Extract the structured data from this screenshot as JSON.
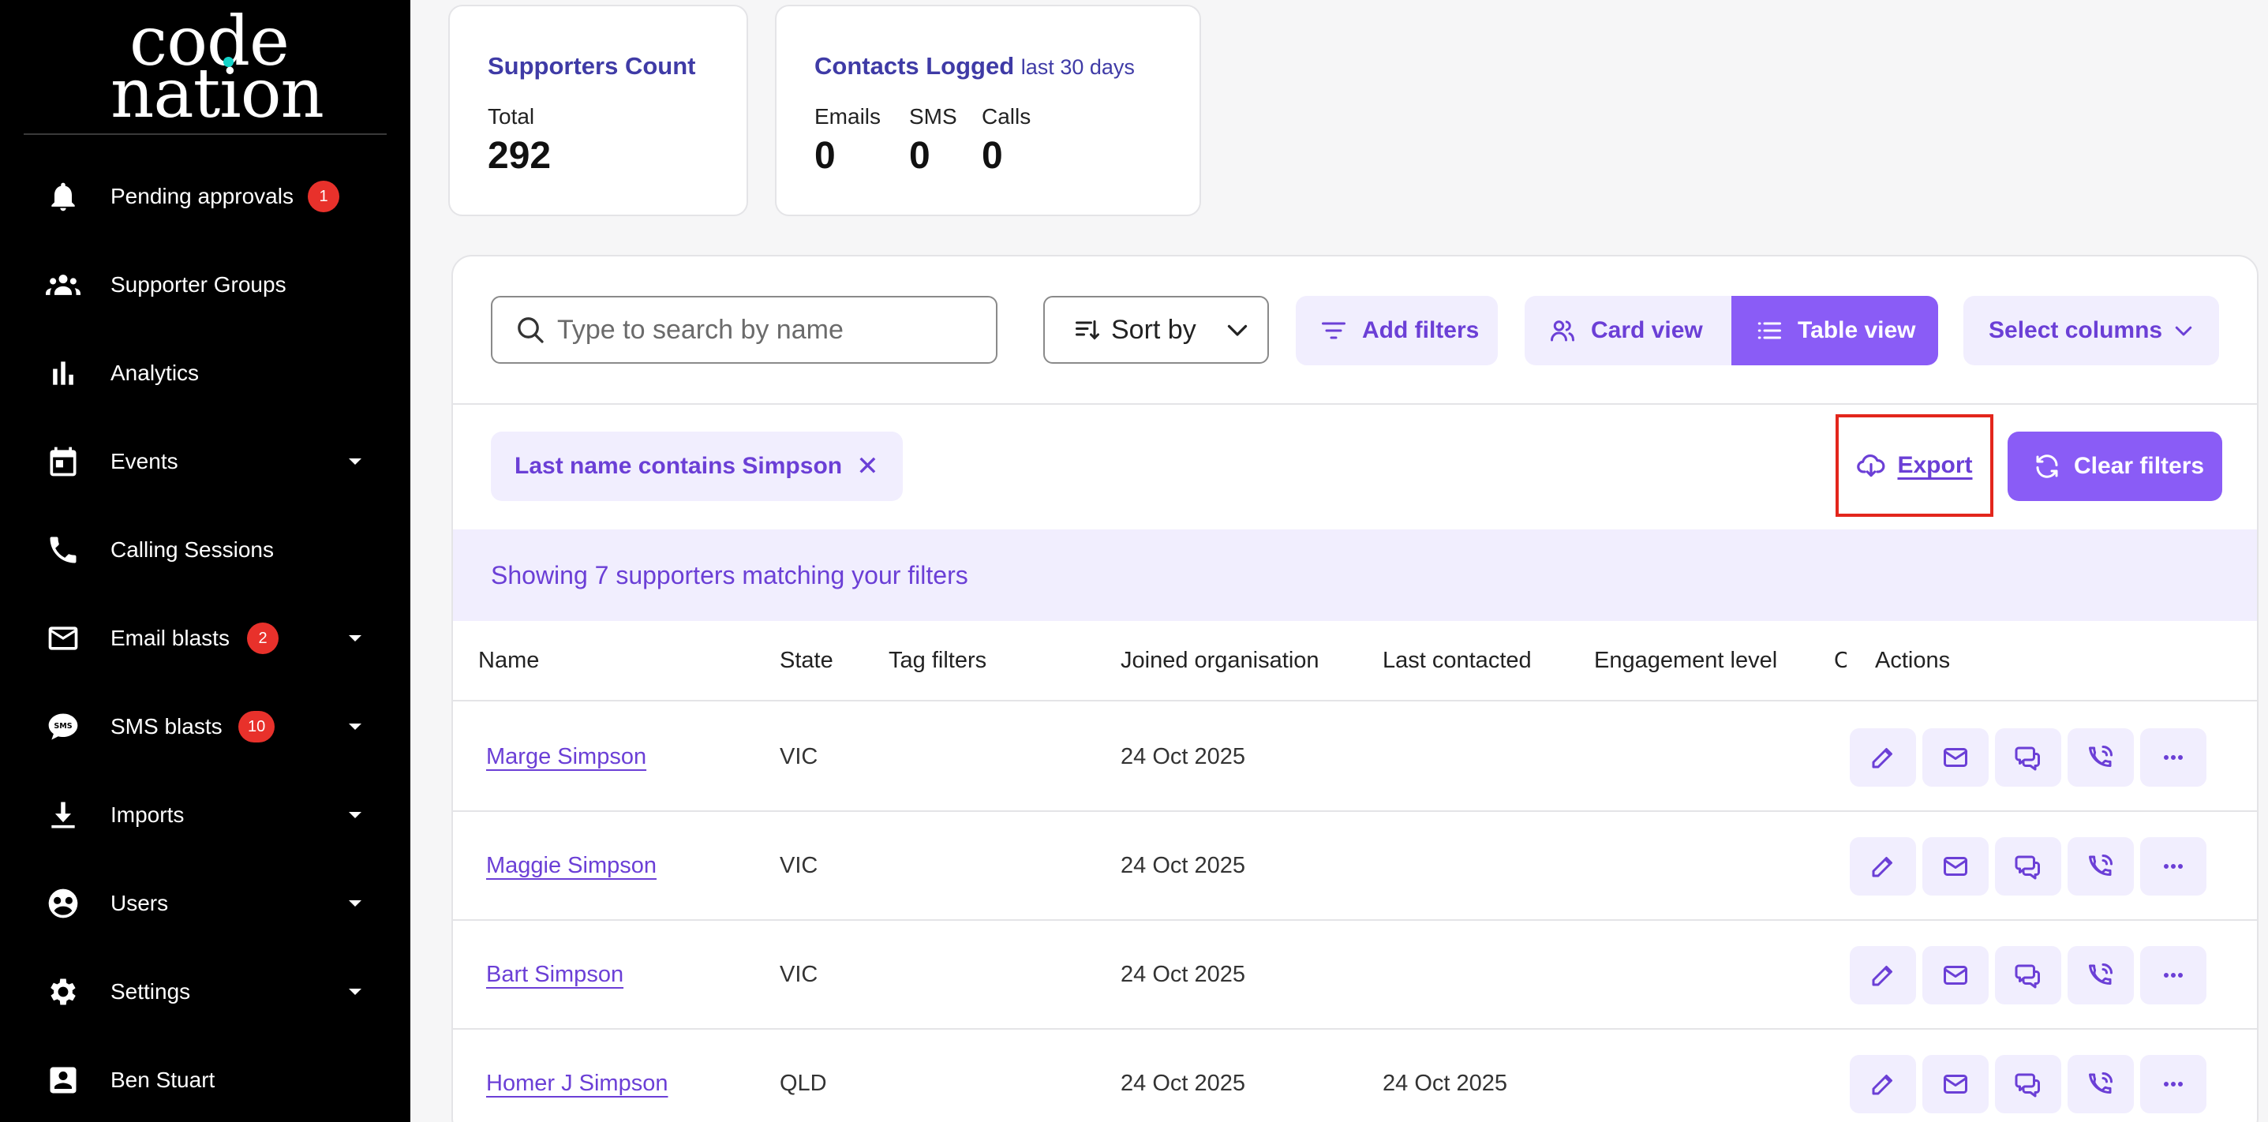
{
  "brand": {
    "line1": "code",
    "line2": "nation"
  },
  "sidebar": {
    "items": [
      {
        "label": "Pending approvals",
        "icon": "bell-icon",
        "badge": "1"
      },
      {
        "label": "Supporter Groups",
        "icon": "groups-icon"
      },
      {
        "label": "Analytics",
        "icon": "bar-chart-icon"
      },
      {
        "label": "Events",
        "icon": "calendar-icon",
        "expandable": true
      },
      {
        "label": "Calling Sessions",
        "icon": "phone-icon"
      },
      {
        "label": "Email blasts",
        "icon": "mail-icon",
        "badge": "2",
        "expandable": true
      },
      {
        "label": "SMS blasts",
        "icon": "sms-icon",
        "badge": "10",
        "expandable": true
      },
      {
        "label": "Imports",
        "icon": "download-icon",
        "expandable": true
      },
      {
        "label": "Users",
        "icon": "users-icon",
        "expandable": true
      },
      {
        "label": "Settings",
        "icon": "gear-icon",
        "expandable": true
      },
      {
        "label": "Ben Stuart",
        "icon": "account-icon"
      }
    ]
  },
  "stats": {
    "supporters": {
      "title": "Supporters Count",
      "label": "Total",
      "value": "292"
    },
    "contacts": {
      "title": "Contacts Logged",
      "subtitle": "last 30 days",
      "emails_label": "Emails",
      "emails_value": "0",
      "sms_label": "SMS",
      "sms_value": "0",
      "calls_label": "Calls",
      "calls_value": "0"
    }
  },
  "toolbar": {
    "search_placeholder": "Type to search by name",
    "sort_label": "Sort by",
    "add_filters_label": "Add filters",
    "card_view_label": "Card view",
    "table_view_label": "Table view",
    "select_columns_label": "Select columns",
    "active_view": "table"
  },
  "filters": {
    "active_chip": "Last name contains Simpson",
    "export_label": "Export",
    "clear_label": "Clear filters",
    "result_text": "Showing 7 supporters matching your filters"
  },
  "table": {
    "columns": [
      "Name",
      "State",
      "Tag filters",
      "Joined organisation",
      "Last contacted",
      "Engagement level",
      "C",
      "Actions"
    ],
    "rows": [
      {
        "name": "Marge Simpson",
        "state": "VIC",
        "tags": "",
        "joined": "24 Oct 2025",
        "last_contacted": "",
        "engagement": ""
      },
      {
        "name": "Maggie Simpson",
        "state": "VIC",
        "tags": "",
        "joined": "24 Oct 2025",
        "last_contacted": "",
        "engagement": ""
      },
      {
        "name": "Bart Simpson",
        "state": "VIC",
        "tags": "",
        "joined": "24 Oct 2025",
        "last_contacted": "",
        "engagement": ""
      },
      {
        "name": "Homer J Simpson",
        "state": "QLD",
        "tags": "",
        "joined": "24 Oct 2025",
        "last_contacted": "24 Oct 2025",
        "engagement": ""
      }
    ],
    "action_icons": [
      "edit-icon",
      "mail-icon",
      "chat-icon",
      "phone-call-icon",
      "more-icon"
    ]
  },
  "colors": {
    "accent": "#8a5cf6",
    "accent_text": "#6b3fd6",
    "accent_soft": "#f1eefe",
    "title_blue": "#3f3ba6",
    "badge_red": "#e8312b",
    "highlight_red": "#e3261c"
  }
}
